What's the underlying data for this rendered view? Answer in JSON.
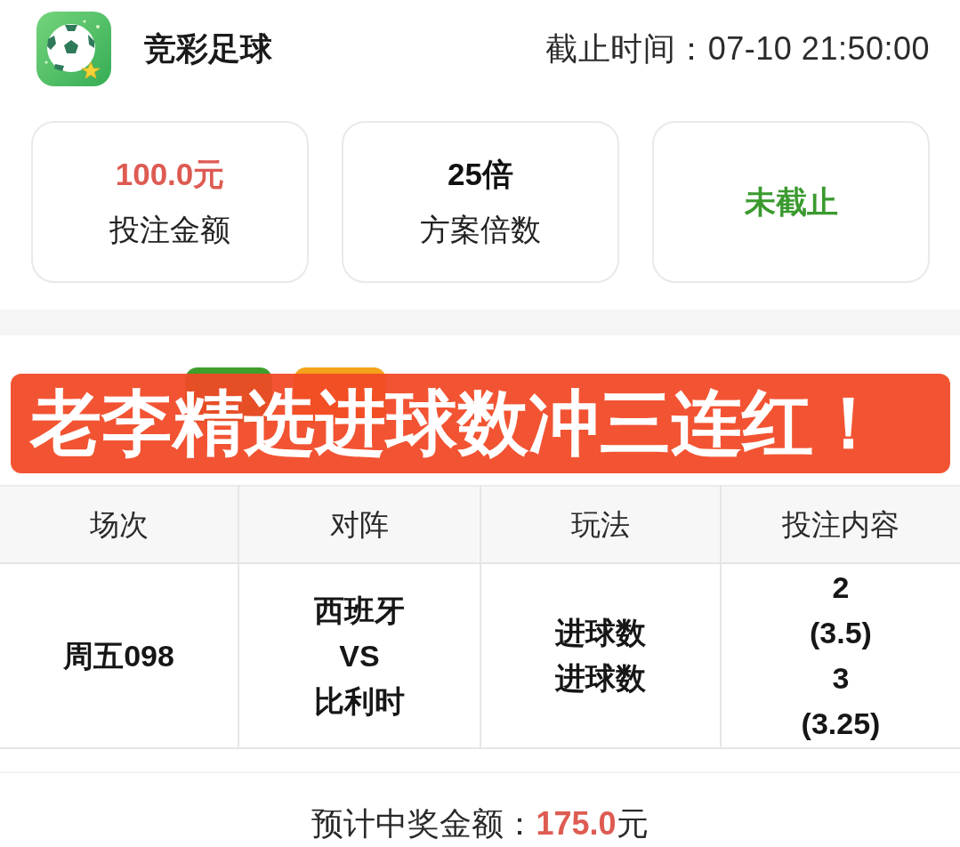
{
  "header": {
    "title": "竞彩足球",
    "deadline": "截止时间：07-10 21:50:00"
  },
  "stats": [
    {
      "kind": "amount",
      "value": "100.0元",
      "label": "投注金额"
    },
    {
      "kind": "plain",
      "value": "25倍",
      "label": "方案倍数"
    },
    {
      "kind": "status",
      "value": "未截止"
    }
  ],
  "tags": [
    {
      "color": "#3f9e2c"
    },
    {
      "color": "#f5a31a"
    }
  ],
  "banner": {
    "text": "老李精选进球数冲三连红！"
  },
  "table": {
    "columns": [
      "场次",
      "对阵",
      "玩法",
      "投注内容"
    ],
    "rows": [
      {
        "cells": [
          [
            "周五098"
          ],
          [
            "西班牙",
            "VS",
            "比利时"
          ],
          [
            "进球数",
            "进球数"
          ],
          [
            "2",
            "(3.5)",
            "3",
            "(3.25)"
          ]
        ]
      }
    ]
  },
  "footer": {
    "text": "预计中奖金额：**175.0**元"
  }
}
